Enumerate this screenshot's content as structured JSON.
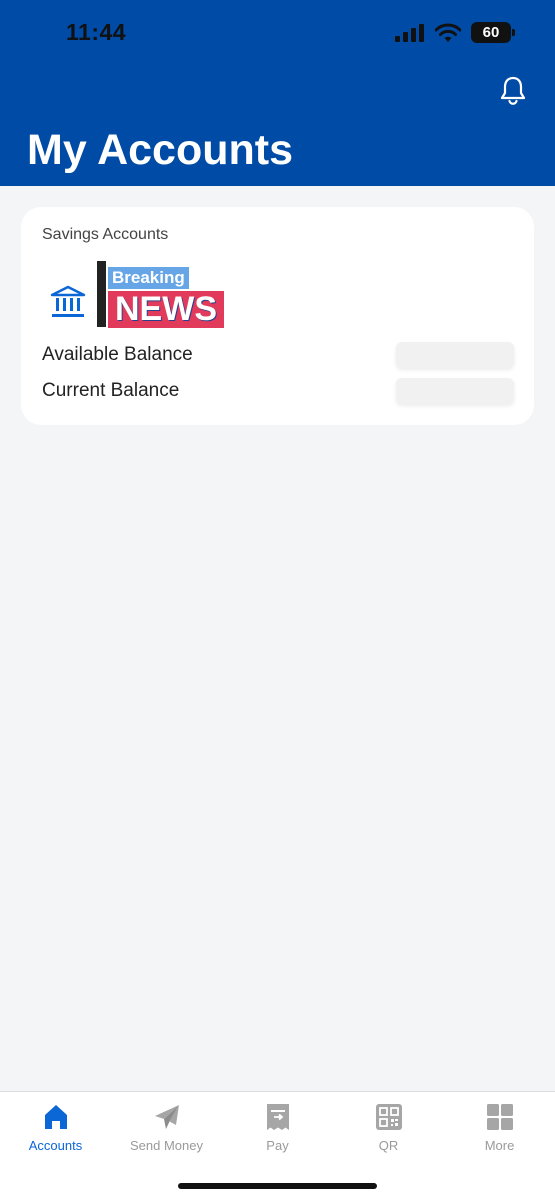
{
  "status_bar": {
    "time": "11:44",
    "battery": "60"
  },
  "header": {
    "title": "My Accounts"
  },
  "card": {
    "section_title": "Savings Accounts",
    "logo": {
      "top_text": "Breaking",
      "main_text": "NEWS"
    },
    "balances": [
      {
        "label": "Available Balance"
      },
      {
        "label": "Current Balance"
      }
    ]
  },
  "tabs": [
    {
      "label": "Accounts",
      "icon": "home-icon",
      "active": true
    },
    {
      "label": "Send Money",
      "icon": "paper-plane-icon",
      "active": false
    },
    {
      "label": "Pay",
      "icon": "bill-icon",
      "active": false
    },
    {
      "label": "QR",
      "icon": "qr-code-icon",
      "active": false
    },
    {
      "label": "More",
      "icon": "grid-icon",
      "active": false
    }
  ],
  "colors": {
    "brand_blue": "#004ba5",
    "active_tab": "#0b66d6",
    "inactive_tab": "#9a9a9a",
    "background": "#f4f5f7"
  }
}
